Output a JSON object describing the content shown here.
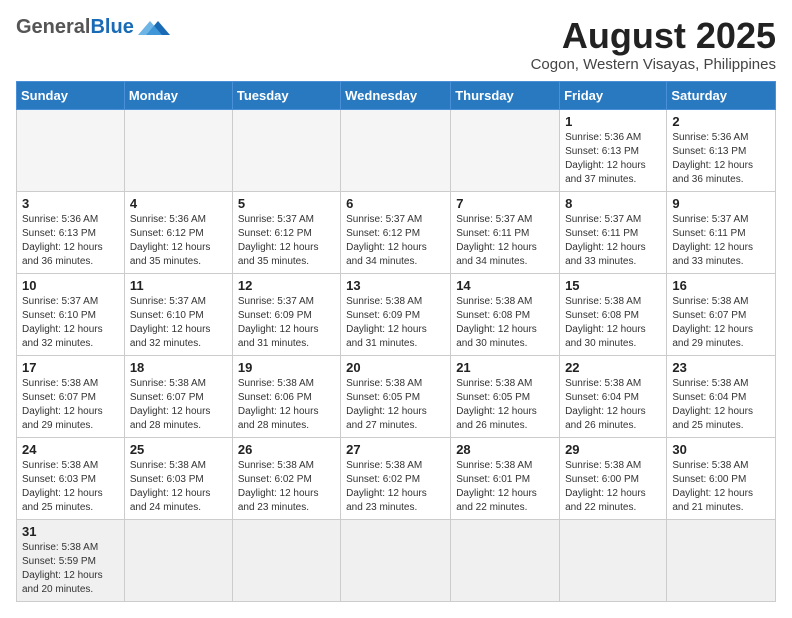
{
  "header": {
    "logo_general": "General",
    "logo_blue": "Blue",
    "month_title": "August 2025",
    "subtitle": "Cogon, Western Visayas, Philippines"
  },
  "weekdays": [
    "Sunday",
    "Monday",
    "Tuesday",
    "Wednesday",
    "Thursday",
    "Friday",
    "Saturday"
  ],
  "weeks": [
    [
      {
        "day": "",
        "info": ""
      },
      {
        "day": "",
        "info": ""
      },
      {
        "day": "",
        "info": ""
      },
      {
        "day": "",
        "info": ""
      },
      {
        "day": "",
        "info": ""
      },
      {
        "day": "1",
        "info": "Sunrise: 5:36 AM\nSunset: 6:13 PM\nDaylight: 12 hours\nand 37 minutes."
      },
      {
        "day": "2",
        "info": "Sunrise: 5:36 AM\nSunset: 6:13 PM\nDaylight: 12 hours\nand 36 minutes."
      }
    ],
    [
      {
        "day": "3",
        "info": "Sunrise: 5:36 AM\nSunset: 6:13 PM\nDaylight: 12 hours\nand 36 minutes."
      },
      {
        "day": "4",
        "info": "Sunrise: 5:36 AM\nSunset: 6:12 PM\nDaylight: 12 hours\nand 35 minutes."
      },
      {
        "day": "5",
        "info": "Sunrise: 5:37 AM\nSunset: 6:12 PM\nDaylight: 12 hours\nand 35 minutes."
      },
      {
        "day": "6",
        "info": "Sunrise: 5:37 AM\nSunset: 6:12 PM\nDaylight: 12 hours\nand 34 minutes."
      },
      {
        "day": "7",
        "info": "Sunrise: 5:37 AM\nSunset: 6:11 PM\nDaylight: 12 hours\nand 34 minutes."
      },
      {
        "day": "8",
        "info": "Sunrise: 5:37 AM\nSunset: 6:11 PM\nDaylight: 12 hours\nand 33 minutes."
      },
      {
        "day": "9",
        "info": "Sunrise: 5:37 AM\nSunset: 6:11 PM\nDaylight: 12 hours\nand 33 minutes."
      }
    ],
    [
      {
        "day": "10",
        "info": "Sunrise: 5:37 AM\nSunset: 6:10 PM\nDaylight: 12 hours\nand 32 minutes."
      },
      {
        "day": "11",
        "info": "Sunrise: 5:37 AM\nSunset: 6:10 PM\nDaylight: 12 hours\nand 32 minutes."
      },
      {
        "day": "12",
        "info": "Sunrise: 5:37 AM\nSunset: 6:09 PM\nDaylight: 12 hours\nand 31 minutes."
      },
      {
        "day": "13",
        "info": "Sunrise: 5:38 AM\nSunset: 6:09 PM\nDaylight: 12 hours\nand 31 minutes."
      },
      {
        "day": "14",
        "info": "Sunrise: 5:38 AM\nSunset: 6:08 PM\nDaylight: 12 hours\nand 30 minutes."
      },
      {
        "day": "15",
        "info": "Sunrise: 5:38 AM\nSunset: 6:08 PM\nDaylight: 12 hours\nand 30 minutes."
      },
      {
        "day": "16",
        "info": "Sunrise: 5:38 AM\nSunset: 6:07 PM\nDaylight: 12 hours\nand 29 minutes."
      }
    ],
    [
      {
        "day": "17",
        "info": "Sunrise: 5:38 AM\nSunset: 6:07 PM\nDaylight: 12 hours\nand 29 minutes."
      },
      {
        "day": "18",
        "info": "Sunrise: 5:38 AM\nSunset: 6:07 PM\nDaylight: 12 hours\nand 28 minutes."
      },
      {
        "day": "19",
        "info": "Sunrise: 5:38 AM\nSunset: 6:06 PM\nDaylight: 12 hours\nand 28 minutes."
      },
      {
        "day": "20",
        "info": "Sunrise: 5:38 AM\nSunset: 6:05 PM\nDaylight: 12 hours\nand 27 minutes."
      },
      {
        "day": "21",
        "info": "Sunrise: 5:38 AM\nSunset: 6:05 PM\nDaylight: 12 hours\nand 26 minutes."
      },
      {
        "day": "22",
        "info": "Sunrise: 5:38 AM\nSunset: 6:04 PM\nDaylight: 12 hours\nand 26 minutes."
      },
      {
        "day": "23",
        "info": "Sunrise: 5:38 AM\nSunset: 6:04 PM\nDaylight: 12 hours\nand 25 minutes."
      }
    ],
    [
      {
        "day": "24",
        "info": "Sunrise: 5:38 AM\nSunset: 6:03 PM\nDaylight: 12 hours\nand 25 minutes."
      },
      {
        "day": "25",
        "info": "Sunrise: 5:38 AM\nSunset: 6:03 PM\nDaylight: 12 hours\nand 24 minutes."
      },
      {
        "day": "26",
        "info": "Sunrise: 5:38 AM\nSunset: 6:02 PM\nDaylight: 12 hours\nand 23 minutes."
      },
      {
        "day": "27",
        "info": "Sunrise: 5:38 AM\nSunset: 6:02 PM\nDaylight: 12 hours\nand 23 minutes."
      },
      {
        "day": "28",
        "info": "Sunrise: 5:38 AM\nSunset: 6:01 PM\nDaylight: 12 hours\nand 22 minutes."
      },
      {
        "day": "29",
        "info": "Sunrise: 5:38 AM\nSunset: 6:00 PM\nDaylight: 12 hours\nand 22 minutes."
      },
      {
        "day": "30",
        "info": "Sunrise: 5:38 AM\nSunset: 6:00 PM\nDaylight: 12 hours\nand 21 minutes."
      }
    ],
    [
      {
        "day": "31",
        "info": "Sunrise: 5:38 AM\nSunset: 5:59 PM\nDaylight: 12 hours\nand 20 minutes."
      },
      {
        "day": "",
        "info": ""
      },
      {
        "day": "",
        "info": ""
      },
      {
        "day": "",
        "info": ""
      },
      {
        "day": "",
        "info": ""
      },
      {
        "day": "",
        "info": ""
      },
      {
        "day": "",
        "info": ""
      }
    ]
  ]
}
